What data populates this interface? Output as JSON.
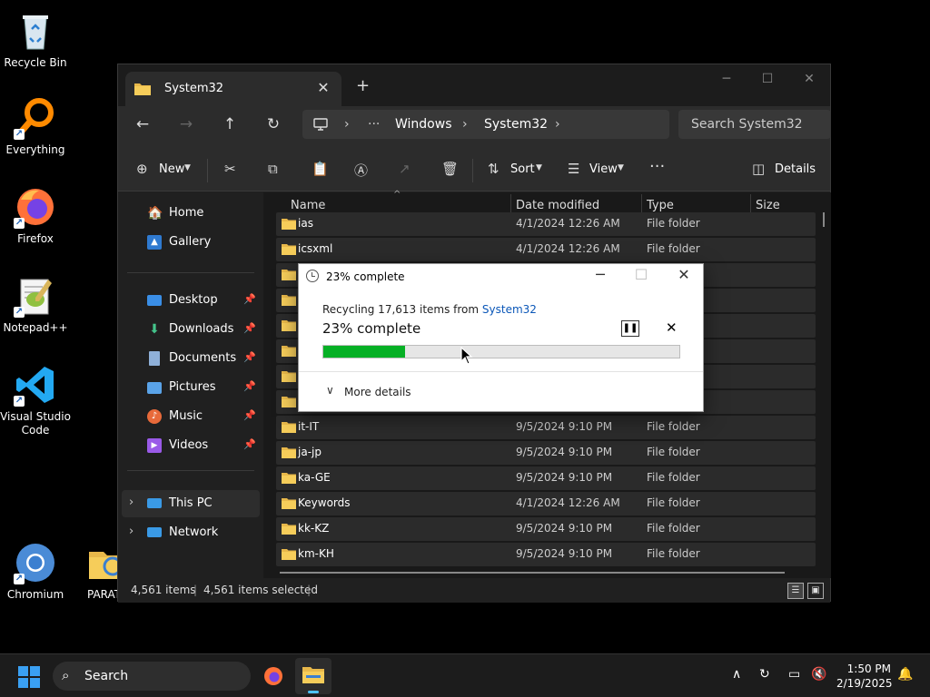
{
  "desktop": {
    "icons": [
      {
        "label": "Recycle Bin"
      },
      {
        "label": "Everything"
      },
      {
        "label": "Firefox"
      },
      {
        "label": "Notepad++"
      },
      {
        "label": "Visual Studio Code"
      },
      {
        "label": "Chromium"
      },
      {
        "label": "PARAT"
      }
    ]
  },
  "explorer": {
    "tab_title": "System32",
    "breadcrumb": [
      "Windows",
      "System32"
    ],
    "search_placeholder": "Search System32",
    "toolbar": {
      "new": "New",
      "sort": "Sort",
      "view": "View",
      "details": "Details"
    },
    "sidebar": {
      "items": [
        {
          "label": "Home",
          "icon": "home-icon"
        },
        {
          "label": "Gallery",
          "icon": "gallery-icon"
        },
        {
          "label": "Desktop",
          "icon": "desktop-icon",
          "pinned": true
        },
        {
          "label": "Downloads",
          "icon": "downloads-icon",
          "pinned": true
        },
        {
          "label": "Documents",
          "icon": "documents-icon",
          "pinned": true
        },
        {
          "label": "Pictures",
          "icon": "pictures-icon",
          "pinned": true
        },
        {
          "label": "Music",
          "icon": "music-icon",
          "pinned": true
        },
        {
          "label": "Videos",
          "icon": "videos-icon",
          "pinned": true
        },
        {
          "label": "This PC",
          "icon": "pc-icon"
        },
        {
          "label": "Network",
          "icon": "network-icon"
        }
      ]
    },
    "columns": {
      "name": "Name",
      "date": "Date modified",
      "type": "Type",
      "size": "Size"
    },
    "rows": [
      {
        "name": "ias",
        "date": "4/1/2024 12:26 AM",
        "type": "File folder"
      },
      {
        "name": "icsxml",
        "date": "4/1/2024 12:26 AM",
        "type": "File folder"
      },
      {
        "name": "",
        "date": "",
        "type": ""
      },
      {
        "name": "",
        "date": "",
        "type": ""
      },
      {
        "name": "",
        "date": "",
        "type": ""
      },
      {
        "name": "",
        "date": "",
        "type": ""
      },
      {
        "name": "",
        "date": "",
        "type": ""
      },
      {
        "name": "",
        "date": "",
        "type": ""
      },
      {
        "name": "it-IT",
        "date": "9/5/2024 9:10 PM",
        "type": "File folder"
      },
      {
        "name": "ja-jp",
        "date": "9/5/2024 9:10 PM",
        "type": "File folder"
      },
      {
        "name": "ka-GE",
        "date": "9/5/2024 9:10 PM",
        "type": "File folder"
      },
      {
        "name": "Keywords",
        "date": "4/1/2024 12:26 AM",
        "type": "File folder"
      },
      {
        "name": "kk-KZ",
        "date": "9/5/2024 9:10 PM",
        "type": "File folder"
      },
      {
        "name": "km-KH",
        "date": "9/5/2024 9:10 PM",
        "type": "File folder"
      }
    ],
    "status": {
      "count": "4,561 items",
      "selected": "4,561 items selected"
    }
  },
  "dialog": {
    "title": "23% complete",
    "line_prefix": "Recycling 17,613 items from ",
    "line_link": "System32",
    "percent_text": "23% complete",
    "progress": 0.23,
    "more_details": "More details",
    "progress_color": "#06b025"
  },
  "taskbar": {
    "search": "Search",
    "time": "1:50 PM",
    "date": "2/19/2025"
  }
}
